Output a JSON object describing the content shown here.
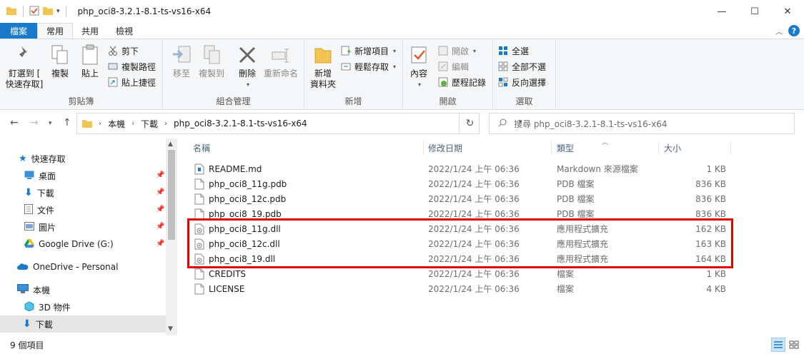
{
  "window": {
    "title": "php_oci8-3.2.1-8.1-ts-vs16-x64",
    "minimize": "—",
    "maximize": "☐",
    "close": "✕"
  },
  "ribbon_tabs": [
    "檔案",
    "常用",
    "共用",
    "檢視"
  ],
  "ribbon": {
    "clipboard": {
      "label": "剪貼簿",
      "pin_quick_access": "釘選到 [\n快速存取]",
      "copy": "複製",
      "paste": "貼上",
      "cut": "剪下",
      "copy_path": "複製路徑",
      "paste_shortcut": "貼上捷徑"
    },
    "organize": {
      "label": "組合管理",
      "move_to": "移至",
      "copy_to": "複製到",
      "delete": "刪除",
      "rename": "重新命名"
    },
    "new": {
      "label": "新增",
      "new_folder": "新增\n資料夾",
      "new_item": "新增項目",
      "easy_access": "輕鬆存取"
    },
    "open": {
      "label": "開啟",
      "properties": "內容",
      "open": "開啟",
      "edit": "編輯",
      "history": "歷程記錄"
    },
    "select": {
      "label": "選取",
      "select_all": "全選",
      "select_none": "全部不選",
      "invert": "反向選擇"
    }
  },
  "address_bar": {
    "crumbs": [
      "本機",
      "下載",
      "php_oci8-3.2.1-8.1-ts-vs16-x64"
    ],
    "search_placeholder": "搜尋 php_oci8-3.2.1-8.1-ts-vs16-x64"
  },
  "nav_pane": {
    "quick_access": "快速存取",
    "items": [
      {
        "label": "桌面",
        "icon": "desktop-icon",
        "pinned": true
      },
      {
        "label": "下載",
        "icon": "download-icon",
        "pinned": true
      },
      {
        "label": "文件",
        "icon": "document-icon",
        "pinned": true
      },
      {
        "label": "圖片",
        "icon": "picture-icon",
        "pinned": true
      },
      {
        "label": "Google Drive (G:)",
        "icon": "google-drive-icon",
        "pinned": true
      }
    ],
    "onedrive": "OneDrive - Personal",
    "this_pc": "本機",
    "pc_items": [
      {
        "label": "3D 物件",
        "icon": "cube-icon"
      },
      {
        "label": "下載",
        "icon": "download-icon",
        "selected": true
      }
    ]
  },
  "columns": {
    "name": "名稱",
    "modified": "修改日期",
    "type": "類型",
    "size": "大小"
  },
  "files": [
    {
      "name": "README.md",
      "modified": "2022/1/24 上午 06:36",
      "type": "Markdown 來源檔案",
      "size": "1 KB",
      "icon": "markdown-file-icon"
    },
    {
      "name": "php_oci8_11g.pdb",
      "modified": "2022/1/24 上午 06:36",
      "type": "PDB 檔案",
      "size": "836 KB",
      "icon": "file-icon"
    },
    {
      "name": "php_oci8_12c.pdb",
      "modified": "2022/1/24 上午 06:36",
      "type": "PDB 檔案",
      "size": "836 KB",
      "icon": "file-icon"
    },
    {
      "name": "php_oci8_19.pdb",
      "modified": "2022/1/24 上午 06:36",
      "type": "PDB 檔案",
      "size": "836 KB",
      "icon": "file-icon"
    },
    {
      "name": "php_oci8_11g.dll",
      "modified": "2022/1/24 上午 06:36",
      "type": "應用程式擴充",
      "size": "162 KB",
      "icon": "dll-file-icon"
    },
    {
      "name": "php_oci8_12c.dll",
      "modified": "2022/1/24 上午 06:36",
      "type": "應用程式擴充",
      "size": "163 KB",
      "icon": "dll-file-icon"
    },
    {
      "name": "php_oci8_19.dll",
      "modified": "2022/1/24 上午 06:36",
      "type": "應用程式擴充",
      "size": "164 KB",
      "icon": "dll-file-icon"
    },
    {
      "name": "CREDITS",
      "modified": "2022/1/24 上午 06:36",
      "type": "檔案",
      "size": "1 KB",
      "icon": "file-icon"
    },
    {
      "name": "LICENSE",
      "modified": "2022/1/24 上午 06:36",
      "type": "檔案",
      "size": "4 KB",
      "icon": "file-icon"
    }
  ],
  "status": {
    "item_count": "9 個項目"
  },
  "colors": {
    "accent": "#1979ca",
    "highlight_box": "#e00000",
    "folder": "#f2c451"
  }
}
